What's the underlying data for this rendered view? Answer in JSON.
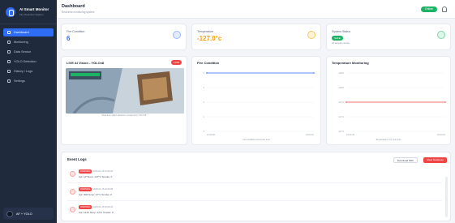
{
  "app": {
    "name": "AI Smart Monitor",
    "subtitle": "Fire Detection System"
  },
  "nav": [
    {
      "label": "Dashboard",
      "active": true
    },
    {
      "label": "Monitoring",
      "active": false
    },
    {
      "label": "Data Sensor",
      "active": false
    },
    {
      "label": "YOLO Detection",
      "active": false
    },
    {
      "label": "History / Logs",
      "active": false
    },
    {
      "label": "Settings",
      "active": false
    }
  ],
  "user": {
    "name": "AF + YOLO"
  },
  "header": {
    "title": "Dashboard",
    "subtitle": "Real-time monitoring system",
    "status": "Online"
  },
  "stats": {
    "fire": {
      "label": "Fire Condition",
      "value": "6"
    },
    "temp": {
      "label": "Temperature",
      "value": "-127.0°c"
    },
    "system": {
      "label": "System Status",
      "value": "SAFE",
      "note": "All sensors normal"
    }
  },
  "camera": {
    "title": "LIVE AI Vision - YOLOv8",
    "badge": "LIVE",
    "caption": "Real-time object detection powered by YOLOv8"
  },
  "fire_chart": {
    "title": "Fire Condition",
    "note": "Fire condition trend over time",
    "y_ticks": [
      "4",
      "3",
      "2",
      "1",
      "0"
    ],
    "x_ticks": [
      "10:00:00",
      "10:00:10"
    ]
  },
  "temp_chart": {
    "title": "Temperature Monitoring",
    "note": "Temperature (°C) over time",
    "y_ticks": [
      "-126.5",
      "-126.8",
      "-127.0",
      "-127.2",
      "-127.5"
    ],
    "x_ticks": [
      "10:00:00",
      "10:00:10"
    ]
  },
  "chart_data": [
    {
      "type": "line",
      "title": "Fire Condition",
      "x": [
        "10:00:00",
        "10:00:10"
      ],
      "series": [
        {
          "values": [
            4,
            4
          ]
        }
      ],
      "ylim": [
        0,
        4
      ]
    },
    {
      "type": "line",
      "title": "Temperature Monitoring",
      "x": [
        "10:00:00",
        "10:00:10"
      ],
      "series": [
        {
          "values": [
            -127.0,
            -127.0
          ]
        }
      ],
      "ylim": [
        -127.5,
        -126.5
      ]
    }
  ],
  "logs": {
    "title": "Event Logs",
    "download": "Download PDF",
    "clear": "Clear Database",
    "items": [
      {
        "tag": "WARNING",
        "time": "2025-01-15 10:00:00",
        "meta": "Api: 1P   Temp: 127°C   Smoke: 0"
      },
      {
        "tag": "WARNING",
        "time": "2025-01-15 10:00:05",
        "meta": "Api: 408   Temp: 47°C   Smoke: 0"
      },
      {
        "tag": "WARNING",
        "time": "2025-01-15 10:00:10",
        "meta": "Api: 1316   Temp: 43°C   Smoke: 0"
      }
    ]
  }
}
